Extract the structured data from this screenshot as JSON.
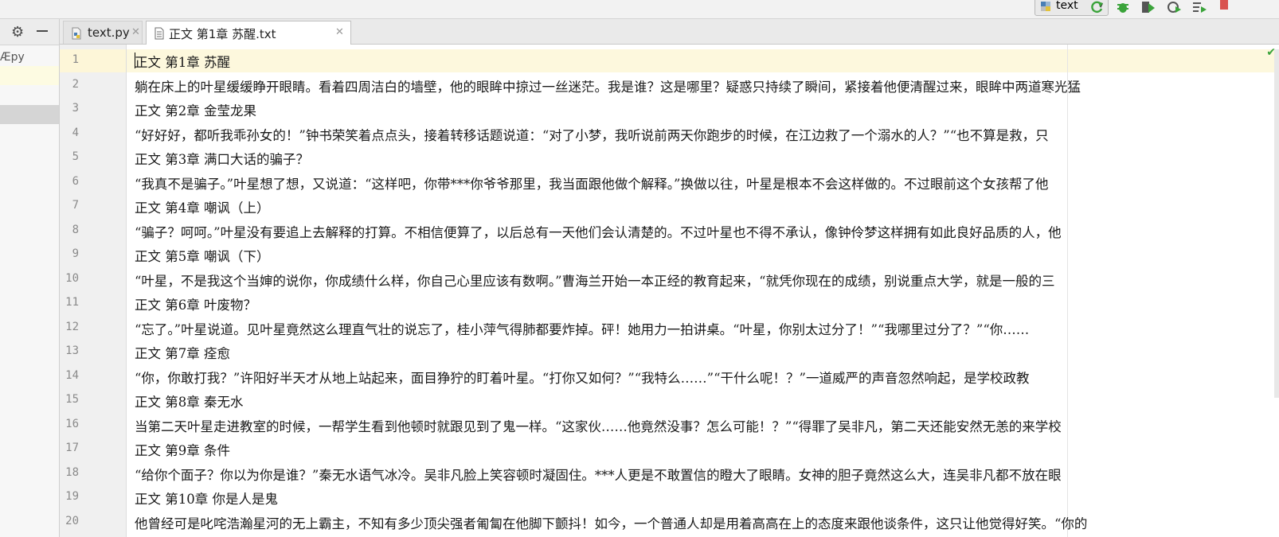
{
  "toolbar": {
    "run_config_label": "text",
    "icons": [
      "rerun-icon",
      "debug-icon",
      "coverage-icon",
      "profile-icon",
      "concurrency-icon",
      "stop-icon"
    ],
    "accent_green": "#3aa33a",
    "accent_red": "#d9534f"
  },
  "project_panel": {
    "partial_file_label": "Æpy",
    "icons": [
      "gear-icon",
      "collapse-icon"
    ]
  },
  "tabs": [
    {
      "label": "text.py",
      "icon": "python-file-icon",
      "active": false
    },
    {
      "label": "正文 第1章 苏醒.txt",
      "icon": "text-file-icon",
      "active": true
    }
  ],
  "editor": {
    "lines": [
      {
        "number": "1",
        "text": "正文 第1章 苏醒"
      },
      {
        "number": "2",
        "text": "躺在床上的叶星缓缓睁开眼睛。看着四周洁白的墙壁，他的眼眸中掠过一丝迷茫。我是谁？这是哪里？疑惑只持续了瞬间，紧接着他便清醒过来，眼眸中两道寒光猛"
      },
      {
        "number": "3",
        "text": "正文 第2章 金莹龙果"
      },
      {
        "number": "4",
        "text": "“好好好，都听我乖孙女的！”钟书荣笑着点点头，接着转移话题说道：“对了小梦，我听说前两天你跑步的时候，在江边救了一个溺水的人？”“也不算是救，只"
      },
      {
        "number": "5",
        "text": "正文 第3章 满口大话的骗子？"
      },
      {
        "number": "6",
        "text": "“我真不是骗子。”叶星想了想，又说道：“这样吧，你带***你爷爷那里，我当面跟他做个解释。”换做以往，叶星是根本不会这样做的。不过眼前这个女孩帮了他"
      },
      {
        "number": "7",
        "text": "正文 第4章 嘲讽（上）"
      },
      {
        "number": "8",
        "text": "“骗子？呵呵。”叶星没有要追上去解释的打算。不相信便算了，以后总有一天他们会认清楚的。不过叶星也不得不承认，像钟伶梦这样拥有如此良好品质的人，他"
      },
      {
        "number": "9",
        "text": "正文 第5章 嘲讽（下）"
      },
      {
        "number": "10",
        "text": "“叶星，不是我这个当婶的说你，你成绩什么样，你自己心里应该有数啊。”曹海兰开始一本正经的教育起来，“就凭你现在的成绩，别说重点大学，就是一般的三"
      },
      {
        "number": "11",
        "text": "正文 第6章 叶废物？"
      },
      {
        "number": "12",
        "text": "“忘了。”叶星说道。见叶星竟然这么理直气壮的说忘了，桂小萍气得肺都要炸掉。砰！她用力一拍讲桌。“叶星，你别太过分了！”“我哪里过分了？”“你……"
      },
      {
        "number": "13",
        "text": "正文 第7章 痊愈"
      },
      {
        "number": "14",
        "text": "“你，你敢打我？”许阳好半天才从地上站起来，面目狰狞的盯着叶星。“打你又如何？”“我特么……”“干什么呢！？”一道威严的声音忽然响起，是学校政教"
      },
      {
        "number": "15",
        "text": "正文 第8章 秦无水"
      },
      {
        "number": "16",
        "text": "当第二天叶星走进教室的时候，一帮学生看到他顿时就跟见到了鬼一样。“这家伙……他竟然没事？怎么可能！？”“得罪了吴非凡，第二天还能安然无恙的来学校"
      },
      {
        "number": "17",
        "text": "正文 第9章 条件"
      },
      {
        "number": "18",
        "text": "“给你个面子？你以为你是谁？”秦无水语气冰冷。吴非凡脸上笑容顿时凝固住。***人更是不敢置信的瞪大了眼睛。女神的胆子竟然这么大，连吴非凡都不放在眼"
      },
      {
        "number": "19",
        "text": "正文 第10章 你是人是鬼"
      },
      {
        "number": "20",
        "text": "他曾经可是叱咤浩瀚星河的无上霸主，不知有多少顶尖强者匍匐在他脚下颤抖！如今，一个普通人却是用着高高在上的态度来跟他谈条件，这只让他觉得好笑。“你的"
      }
    ]
  }
}
